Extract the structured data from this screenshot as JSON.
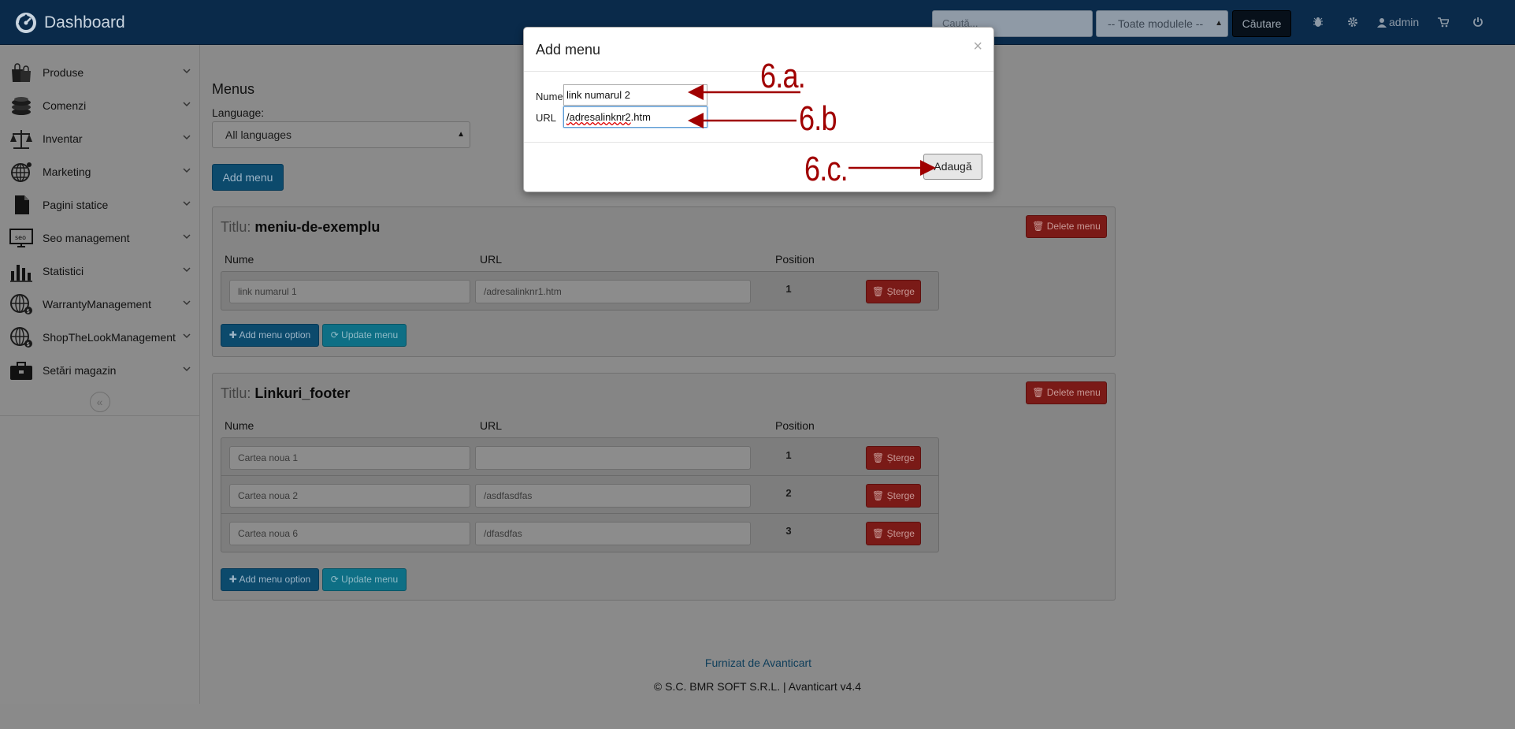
{
  "topbar": {
    "brand": "Dashboard",
    "search_placeholder": "Caută...",
    "module_select": "-- Toate modulele --",
    "search_button": "Căutare",
    "user": "admin"
  },
  "sidebar": {
    "items": [
      {
        "label": "Produse",
        "icon": "shopping-bags-icon"
      },
      {
        "label": "Comenzi",
        "icon": "coins-icon"
      },
      {
        "label": "Inventar",
        "icon": "scale-icon"
      },
      {
        "label": "Marketing",
        "icon": "globe-icon"
      },
      {
        "label": "Pagini statice",
        "icon": "document-icon"
      },
      {
        "label": "Seo management",
        "icon": "seo-monitor-icon"
      },
      {
        "label": "Statistici",
        "icon": "bar-chart-icon"
      },
      {
        "label": "WarrantyManagement",
        "icon": "globe-dollar-icon"
      },
      {
        "label": "ShopTheLookManagement",
        "icon": "globe-dollar-icon"
      },
      {
        "label": "Setări magazin",
        "icon": "briefcase-icon"
      }
    ]
  },
  "main": {
    "title": "Menus",
    "language_label": "Language:",
    "language_value": "All languages",
    "add_menu_button": "Add menu",
    "title_prefix": "Titlu:",
    "delete_menu": "Delete menu",
    "columns": [
      "Nume",
      "URL",
      "Position"
    ],
    "sterge": "Șterge",
    "add_option": "Add menu option",
    "update_menu": "Update menu",
    "menus": [
      {
        "name": "meniu-de-exemplu",
        "rows": [
          {
            "nume": "link numarul 1",
            "url": "/adresalinknr1.htm",
            "position": "1"
          }
        ]
      },
      {
        "name": "Linkuri_footer",
        "rows": [
          {
            "nume": "Cartea noua 1",
            "url": "",
            "position": "1"
          },
          {
            "nume": "Cartea noua 2",
            "url": "/asdfasdfas",
            "position": "2"
          },
          {
            "nume": "Cartea noua 6",
            "url": "/dfasdfas",
            "position": "3"
          }
        ]
      }
    ]
  },
  "footer": {
    "link": "Furnizat de Avanticart",
    "copyright": "© S.C. BMR SOFT S.R.L. | Avanticart v4.4"
  },
  "modal": {
    "title": "Add menu",
    "close": "×",
    "name_label": "Nume",
    "name_value": "link numarul 2",
    "url_label": "URL",
    "url_value_a": "/adresalinknr2",
    "url_value_b": ".htm",
    "submit": "Adaugă"
  },
  "annotations": {
    "a": "6.a.",
    "b": "6.b",
    "c": "6.c."
  },
  "colors": {
    "annotation": "#a00000",
    "primary": "#0c4a6c",
    "danger": "#7a1a17"
  }
}
